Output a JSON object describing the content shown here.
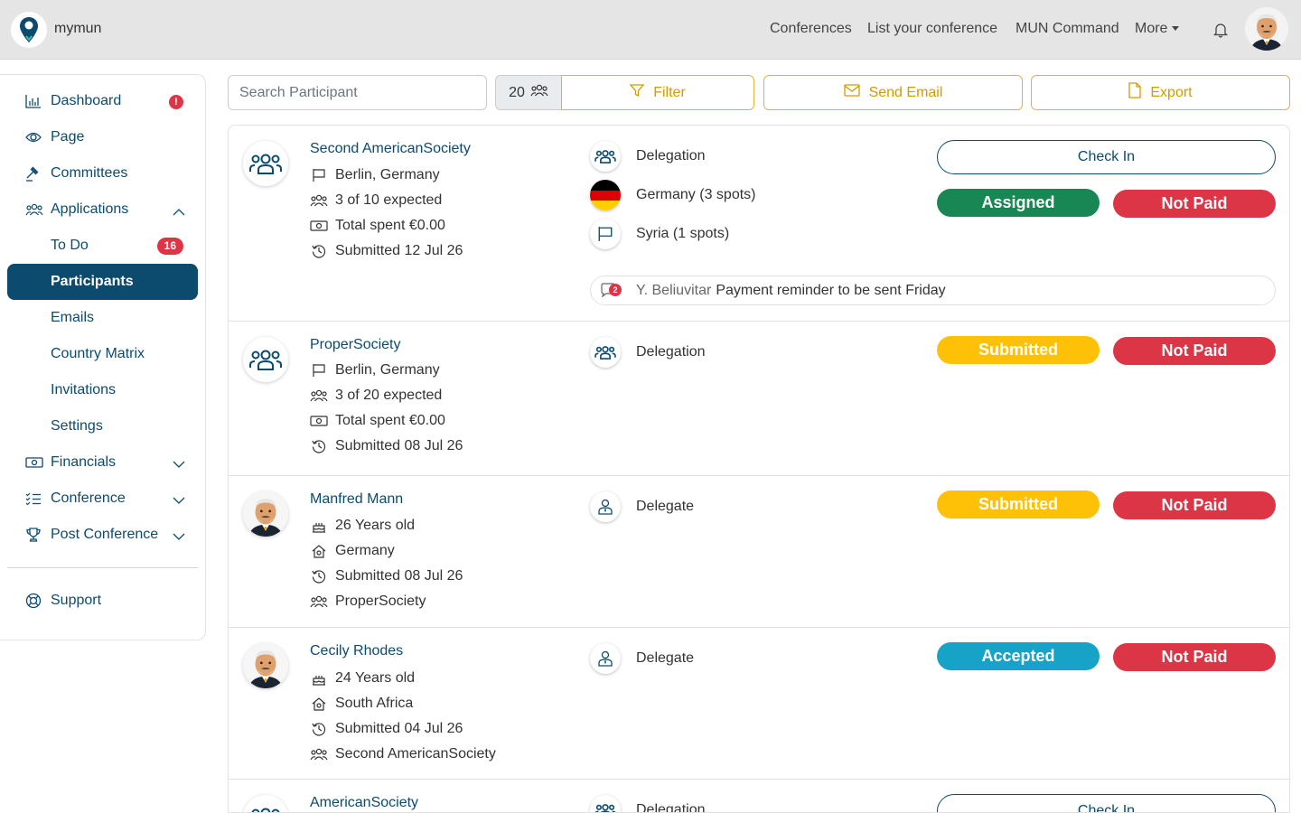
{
  "app": {
    "brand": "mymun"
  },
  "nav": {
    "conferences": "Conferences",
    "list_conference": "List your conference",
    "mun_command": "MUN Command",
    "more": "More"
  },
  "sidebar": {
    "items": [
      {
        "label": "Dashboard"
      },
      {
        "label": "Page"
      },
      {
        "label": "Committees"
      },
      {
        "label": "Applications"
      },
      {
        "label": "To Do",
        "badge": "16"
      },
      {
        "label": "Participants"
      },
      {
        "label": "Emails"
      },
      {
        "label": "Country Matrix"
      },
      {
        "label": "Invitations"
      },
      {
        "label": "Settings"
      },
      {
        "label": "Financials"
      },
      {
        "label": "Conference"
      },
      {
        "label": "Post Conference"
      },
      {
        "label": "Support"
      }
    ],
    "dashboard_alert": "!"
  },
  "toolbar": {
    "search_placeholder": "Search Participant",
    "count": "20",
    "filter_label": "Filter",
    "send_email_label": "Send Email",
    "export_label": "Export"
  },
  "rows": [
    {
      "name": "Second AmericanSociety",
      "lines": [
        "Berlin, Germany",
        "3 of 10 expected",
        "Total spent €0.00",
        "Submitted 12 Jul 26"
      ],
      "type": "Delegation",
      "countries": [
        "Germany (3 spots)",
        "Syria (1 spots)"
      ],
      "check_in": "Check In",
      "status": "Assigned",
      "payment": "Not Paid",
      "note": {
        "count": "2",
        "author": "Y. Beliuvitar",
        "text": "Payment reminder to be sent Friday"
      }
    },
    {
      "name": "ProperSociety",
      "lines": [
        "Berlin, Germany",
        "3 of 20 expected",
        "Total spent €0.00",
        "Submitted 08 Jul 26"
      ],
      "type": "Delegation",
      "status": "Submitted",
      "payment": "Not Paid"
    },
    {
      "name": "Manfred Mann",
      "lines": [
        "26 Years old",
        "Germany",
        "Submitted 08 Jul 26",
        "ProperSociety"
      ],
      "type": "Delegate",
      "status": "Submitted",
      "payment": "Not Paid"
    },
    {
      "name": "Cecily Rhodes",
      "lines": [
        "24 Years old",
        "South Africa",
        "Submitted 04 Jul 26",
        "Second AmericanSociety"
      ],
      "type": "Delegate",
      "status": "Accepted",
      "payment": "Not Paid"
    },
    {
      "name": "AmericanSociety",
      "type": "Delegation",
      "check_in": "Check In"
    }
  ],
  "colors": {
    "primary": "#0c4a6e",
    "accent": "#e0b33a",
    "assigned": "#198754",
    "not_paid": "#dc3545",
    "submitted": "#ffc107",
    "accepted": "#17a2c8"
  }
}
